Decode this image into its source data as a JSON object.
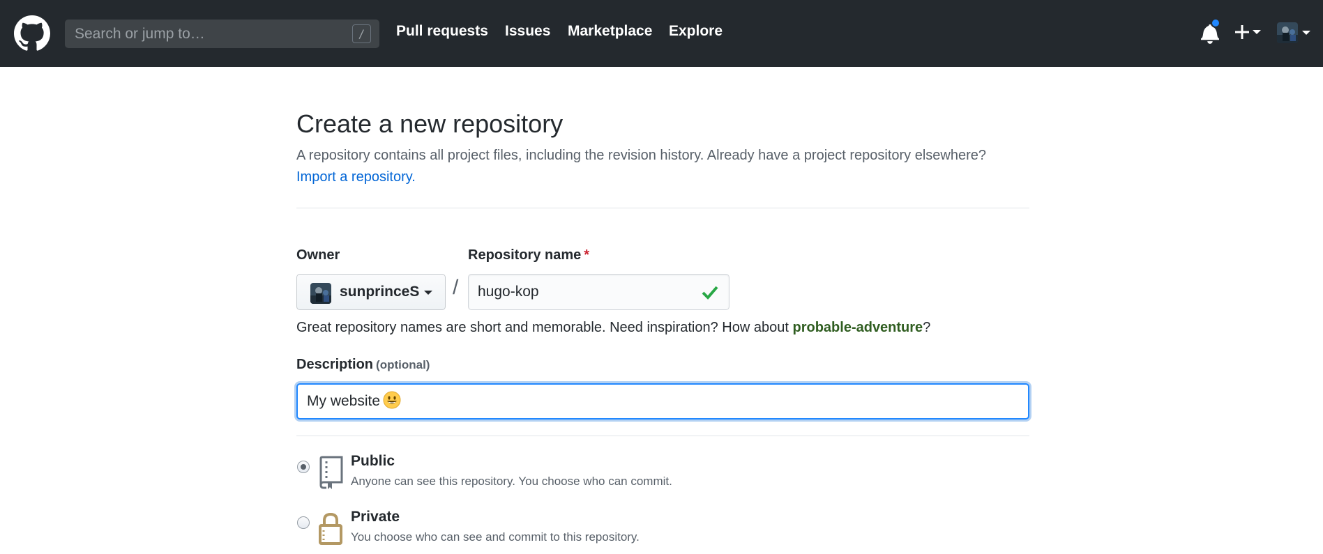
{
  "header": {
    "search_placeholder": "Search or jump to…",
    "search_shortcut": "/",
    "nav": [
      "Pull requests",
      "Issues",
      "Marketplace",
      "Explore"
    ],
    "notification_dot_color": "#2188ff"
  },
  "page": {
    "title": "Create a new repository",
    "subtitle": "A repository contains all project files, including the revision history. Already have a project repository elsewhere?",
    "import_link": "Import a repository."
  },
  "form": {
    "owner_label": "Owner",
    "owner_value": "sunprinceS",
    "separator": "/",
    "repo_label": "Repository name",
    "required_marker": "*",
    "repo_value": "hugo-kop",
    "hint_prefix": "Great repository names are short and memorable. Need inspiration? How about ",
    "hint_suggestion": "probable-adventure",
    "hint_suffix": "?",
    "description_label": "Description",
    "description_optional": "(optional)",
    "description_value": "My website"
  },
  "visibility": {
    "selected": "public",
    "options": [
      {
        "title": "Public",
        "desc": "Anyone can see this repository. You choose who can commit.",
        "icon": "repo-icon"
      },
      {
        "title": "Private",
        "desc": "You choose who can see and commit to this repository.",
        "icon": "lock-icon"
      }
    ]
  }
}
